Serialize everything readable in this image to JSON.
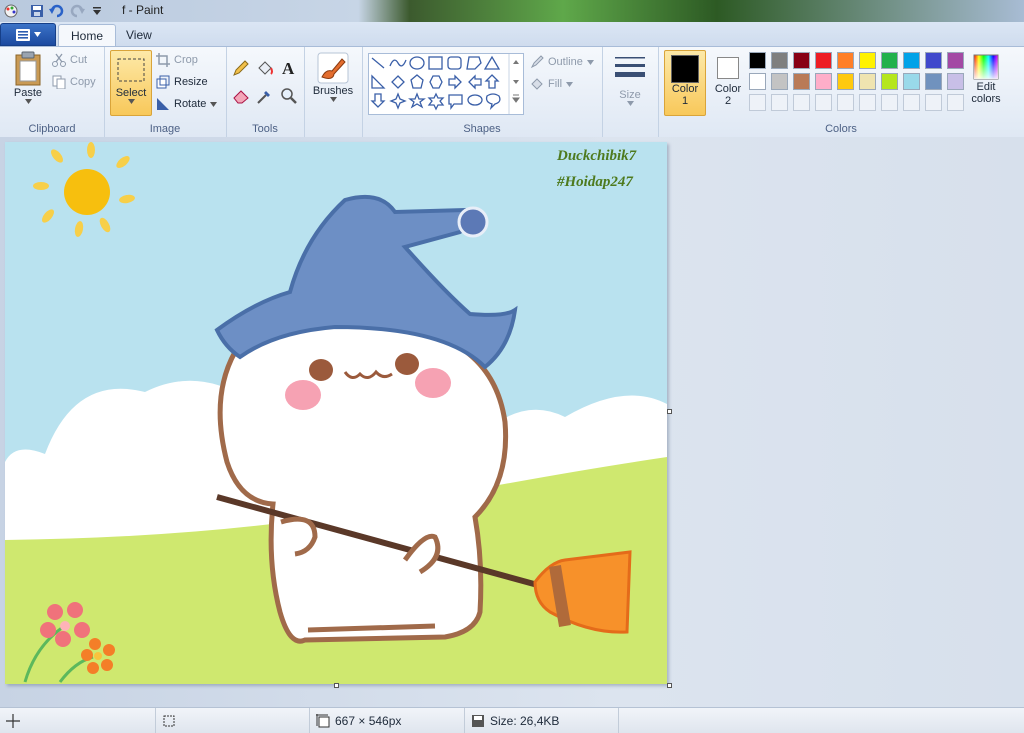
{
  "window": {
    "title": "f - Paint"
  },
  "tabs": [
    {
      "label": "Home"
    },
    {
      "label": "View"
    }
  ],
  "clipboard": {
    "group_label": "Clipboard",
    "paste": "Paste",
    "cut": "Cut",
    "copy": "Copy"
  },
  "image": {
    "group_label": "Image",
    "select": "Select",
    "crop": "Crop",
    "resize": "Resize",
    "rotate": "Rotate"
  },
  "tools": {
    "group_label": "Tools"
  },
  "brushes": {
    "label": "Brushes"
  },
  "shapes": {
    "group_label": "Shapes",
    "outline": "Outline",
    "fill": "Fill"
  },
  "size": {
    "label": "Size"
  },
  "colors": {
    "group_label": "Colors",
    "color1_label": "Color",
    "color1_num": "1",
    "color2_label": "Color",
    "color2_num": "2",
    "color1_value": "#000000",
    "color2_value": "#ffffff",
    "edit_line1": "Edit",
    "edit_line2": "colors",
    "palette_row1": [
      "#000000",
      "#7f7f7f",
      "#880015",
      "#ed1c24",
      "#ff7f27",
      "#fff200",
      "#22b14c",
      "#00a2e8",
      "#3f48cc",
      "#a349a4"
    ],
    "palette_row2": [
      "#ffffff",
      "#c3c3c3",
      "#b97a57",
      "#ffaec9",
      "#ffc90e",
      "#efe4b0",
      "#b5e61d",
      "#99d9ea",
      "#7092be",
      "#c8bfe7"
    ]
  },
  "drawing": {
    "credit_line1": "Duckchibik7",
    "credit_line2": "#Hoidap247"
  },
  "status": {
    "dimensions": "667 × 546px",
    "size": "Size: 26,4KB"
  }
}
